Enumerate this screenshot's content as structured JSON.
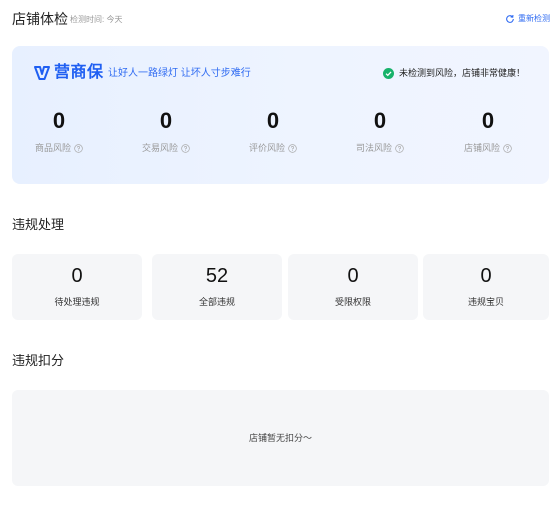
{
  "header": {
    "title": "店铺体检",
    "check_time": "检测时间: 今天",
    "recheck_label": "重新检测"
  },
  "guard": {
    "brand_name": "营商保",
    "slogan": "让好人一路绿灯 让坏人寸步难行",
    "health_status": "未检测到风险，店铺非常健康！",
    "risks": [
      {
        "value": "0",
        "label": "商品风险"
      },
      {
        "value": "0",
        "label": "交易风险"
      },
      {
        "value": "0",
        "label": "评价风险"
      },
      {
        "value": "0",
        "label": "司法风险"
      },
      {
        "value": "0",
        "label": "店铺风险"
      }
    ]
  },
  "violations": {
    "title": "违规处理",
    "items": [
      {
        "value": "0",
        "label": "待处理违规"
      },
      {
        "value": "52",
        "label": "全部违规"
      },
      {
        "value": "0",
        "label": "受限权限"
      },
      {
        "value": "0",
        "label": "违规宝贝"
      }
    ]
  },
  "deduction": {
    "title": "违规扣分",
    "empty_text": "店铺暂无扣分～"
  },
  "colors": {
    "accent": "#2f6bf2",
    "brand": "#1f5ff2",
    "ok_green": "#17b26a",
    "card_bg": "#f5f6f8"
  },
  "icons": {
    "refresh": "refresh-icon",
    "brand": "shield-v-icon",
    "ok": "check-circle-icon",
    "help": "question-circle-icon"
  }
}
